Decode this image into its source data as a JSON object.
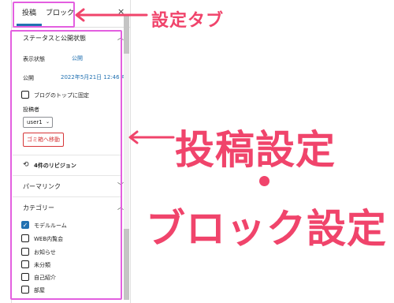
{
  "sidebar": {
    "tabs": [
      {
        "label": "投稿"
      },
      {
        "label": "ブロック"
      }
    ],
    "close_label": "×",
    "status_section": {
      "title": "ステータスと公開状態",
      "visibility_label": "表示状態",
      "visibility_value": "公開",
      "publish_label": "公開",
      "publish_value": "2022年5月21日 12:46 AM",
      "stick_label": "ブログのトップに固定",
      "author_label": "投稿者",
      "author_value": "user1",
      "trash_label": "ゴミ箱へ移動"
    },
    "revisions_label": "4件のリビジョン",
    "permalink_title": "パーマリンク",
    "categories": {
      "title": "カテゴリー",
      "items": [
        {
          "label": "モデルルーム",
          "checked": true
        },
        {
          "label": "WEB内覧会",
          "checked": false
        },
        {
          "label": "お知らせ",
          "checked": false
        },
        {
          "label": "未分類",
          "checked": false
        },
        {
          "label": "自己紹介",
          "checked": false
        },
        {
          "label": "部屋",
          "checked": false
        }
      ]
    }
  },
  "annotations": {
    "tab_label": "設定タブ",
    "big_line1": "投稿設定",
    "big_line2": "ブロック設定"
  },
  "colors": {
    "accent": "#f0446b",
    "highlight": "#e35fe0",
    "link": "#2271b1"
  }
}
